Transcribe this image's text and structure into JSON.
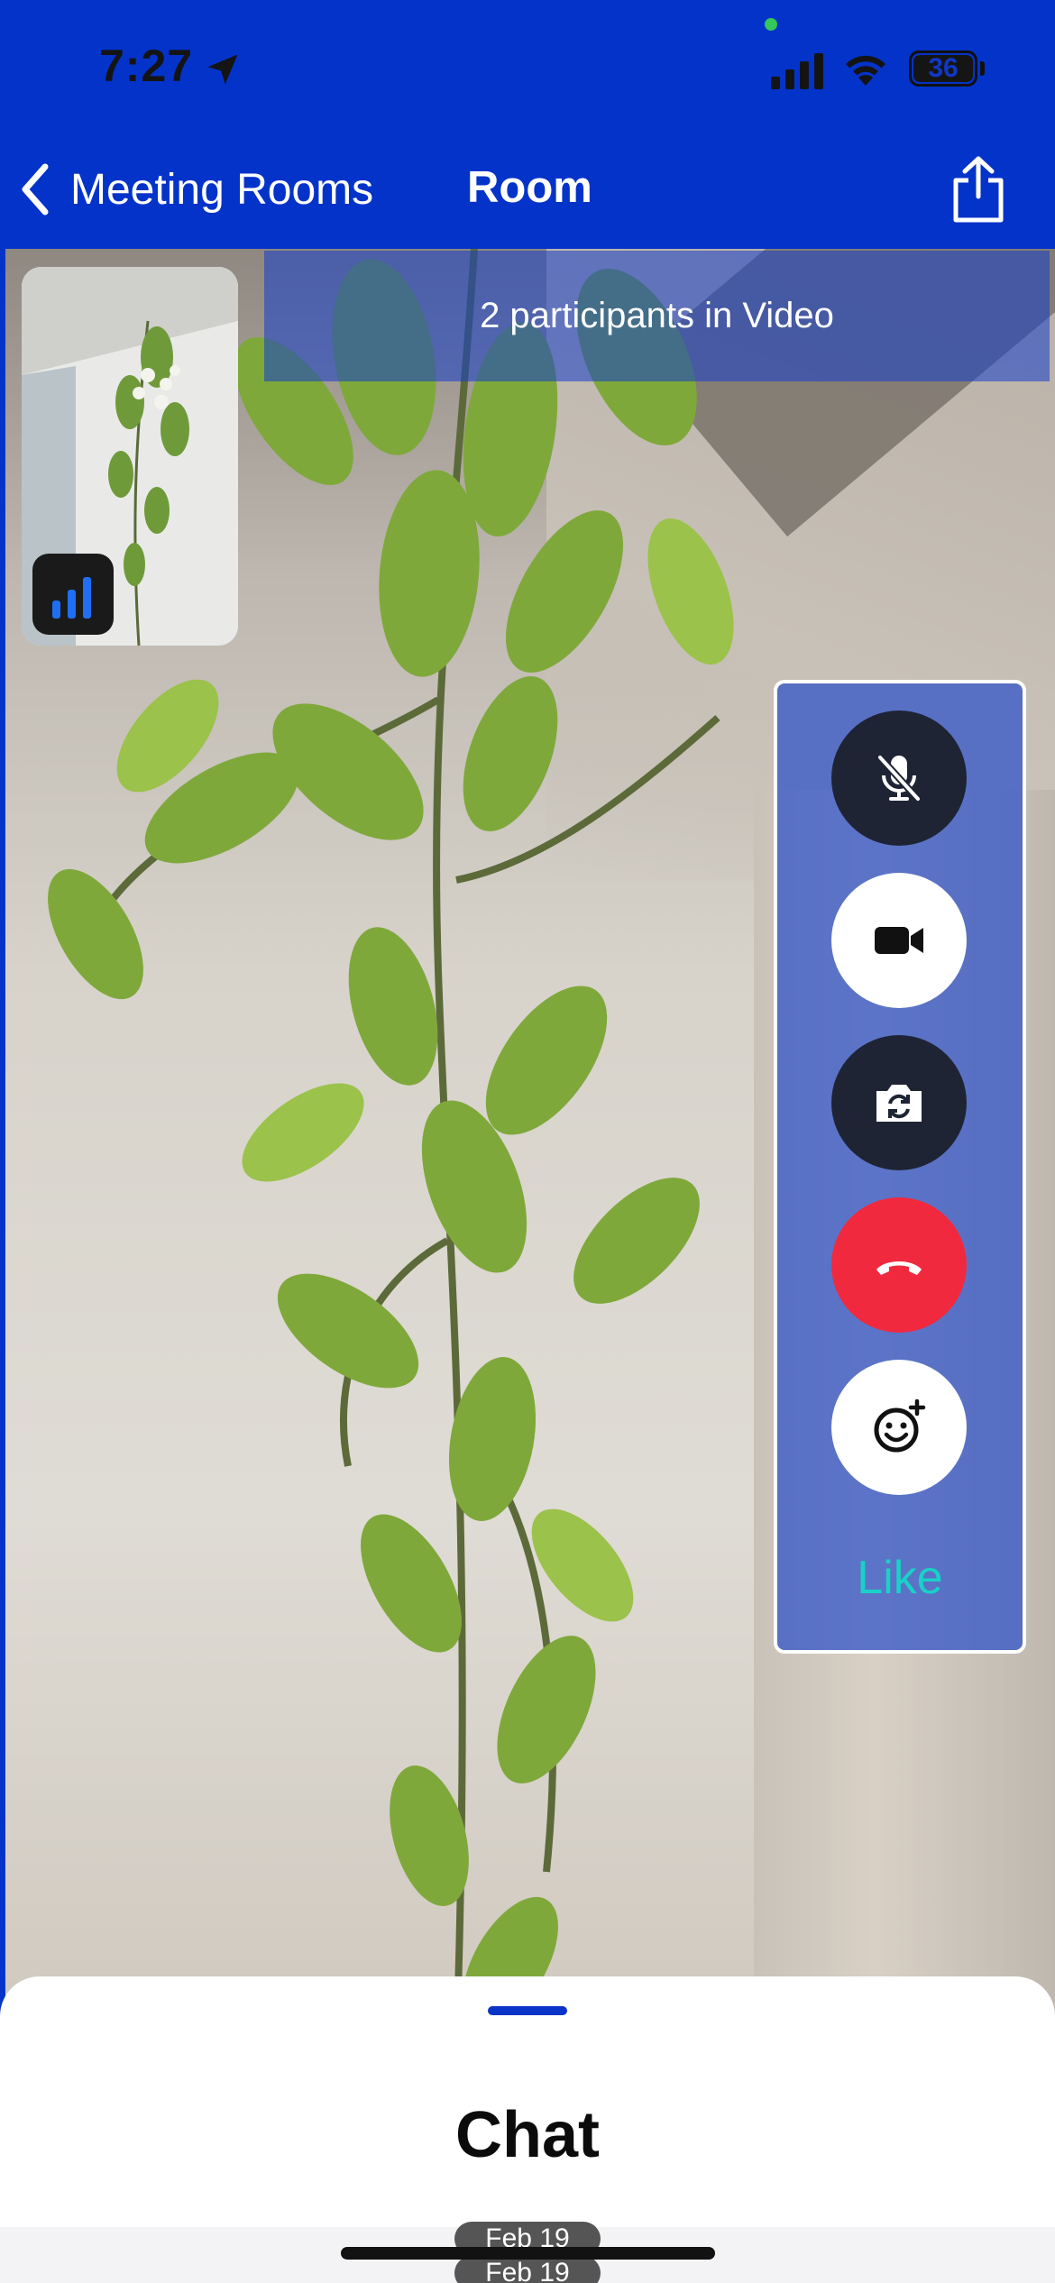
{
  "status_bar": {
    "time": "7:27",
    "battery": "36",
    "icons": [
      "location-arrow-icon",
      "signal-icon",
      "wifi-icon",
      "battery-icon"
    ]
  },
  "nav": {
    "back_label": "Meeting Rooms",
    "title": "Room",
    "icons": [
      "chevron-left-icon",
      "share-icon"
    ]
  },
  "video": {
    "participants_text": "2 participants in Video",
    "network_quality_icon": "signal-bars-icon"
  },
  "controls": {
    "items": [
      {
        "name": "mute-microphone",
        "icon": "microphone-slash-icon",
        "style": "dark"
      },
      {
        "name": "toggle-video",
        "icon": "video-camera-icon",
        "style": "light"
      },
      {
        "name": "switch-camera",
        "icon": "camera-rotate-icon",
        "style": "dark"
      },
      {
        "name": "end-call",
        "icon": "phone-hangup-icon",
        "style": "red"
      },
      {
        "name": "add-reaction",
        "icon": "emoji-add-icon",
        "style": "light"
      }
    ],
    "like_label": "Like"
  },
  "chat": {
    "title": "Chat",
    "dates": [
      "Feb 19",
      "Feb 19"
    ]
  },
  "colors": {
    "brand_blue": "#0433c9",
    "end_call_red": "#f1293e",
    "like_teal": "#19d1c8",
    "control_dark": "#1e2434"
  }
}
